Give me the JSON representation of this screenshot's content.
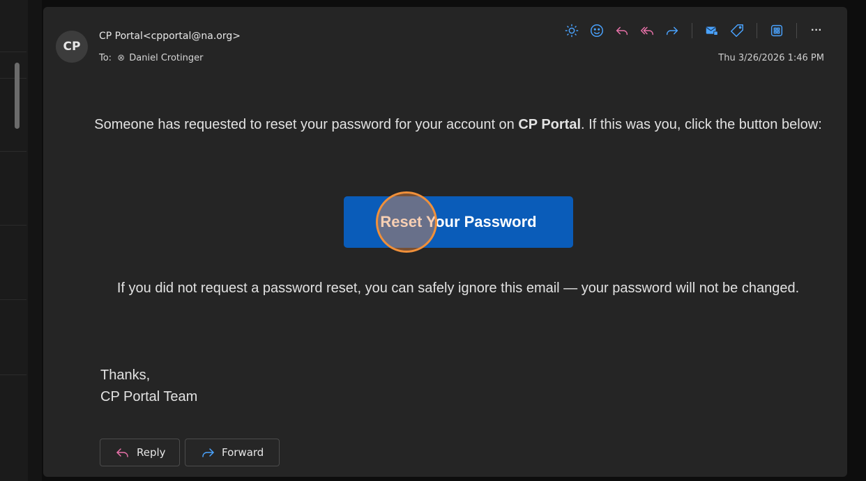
{
  "message": {
    "sender_initials": "CP",
    "from": "CP Portal<cpportal@na.org>",
    "to_label": "To:",
    "to_name": "Daniel Crotinger",
    "timestamp": "Thu 3/26/2026 1:46 PM"
  },
  "toolbar": {
    "icons": [
      "sun-icon",
      "smiley-icon",
      "reply-icon",
      "reply-all-icon",
      "forward-icon",
      "mark-mail-icon",
      "tag-icon",
      "apps-icon",
      "more-icon"
    ],
    "more_label": "···"
  },
  "body": {
    "intro_before": "Someone has requested to reset your password for your account on ",
    "intro_bold": "CP Portal",
    "intro_after": ". If this was you, click the button below:",
    "reset_button": "Reset Your Password",
    "notice": "If you did not request a password reset, you can safely ignore this email — your password will not be changed.",
    "signoff_line1": "Thanks,",
    "signoff_line2": "CP Portal Team"
  },
  "actions": {
    "reply_label": "Reply",
    "forward_label": "Forward"
  },
  "colors": {
    "accent_icon": "#4aa3ff",
    "button_blue": "#0a5cb9",
    "cursor_ring": "#f0903a"
  }
}
